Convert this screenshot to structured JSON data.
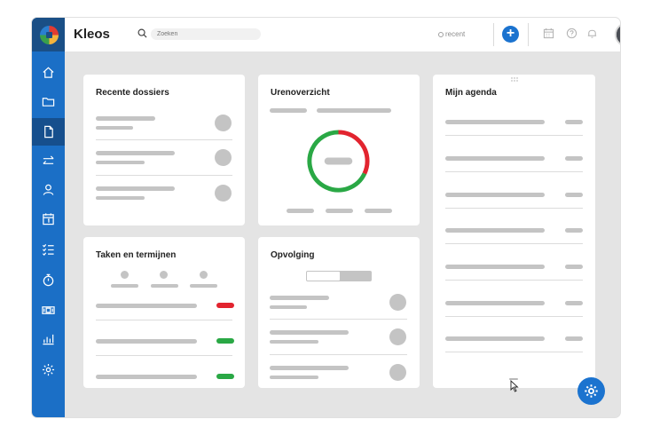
{
  "app": {
    "title": "Kleos"
  },
  "search": {
    "placeholder": "Zoeken"
  },
  "header": {
    "recent_label": "recent",
    "add_label": "+"
  },
  "colors": {
    "accent": "#1b73cf",
    "sidebar": "#1b6fc6",
    "red": "#e2242f",
    "green": "#2aa845"
  },
  "sidebar": {
    "items": [
      {
        "icon": "home-icon"
      },
      {
        "icon": "folder-icon"
      },
      {
        "icon": "document-icon",
        "active": true
      },
      {
        "icon": "transfer-icon"
      },
      {
        "icon": "user-icon"
      },
      {
        "icon": "calendar-icon"
      },
      {
        "icon": "checklist-icon"
      },
      {
        "icon": "stopwatch-icon"
      },
      {
        "icon": "money-icon"
      },
      {
        "icon": "chart-icon"
      },
      {
        "icon": "gear-icon"
      }
    ]
  },
  "widgets": {
    "recent_dossiers": {
      "title": "Recente dossiers"
    },
    "hours": {
      "title": "Urenoverzicht",
      "ring": {
        "red_fraction": 0.32,
        "green_fraction": 0.68
      }
    },
    "agenda": {
      "title": "Mijn agenda"
    },
    "tasks": {
      "title": "Taken en termijnen",
      "status": [
        "red",
        "green",
        "green"
      ]
    },
    "followup": {
      "title": "Opvolging"
    }
  }
}
